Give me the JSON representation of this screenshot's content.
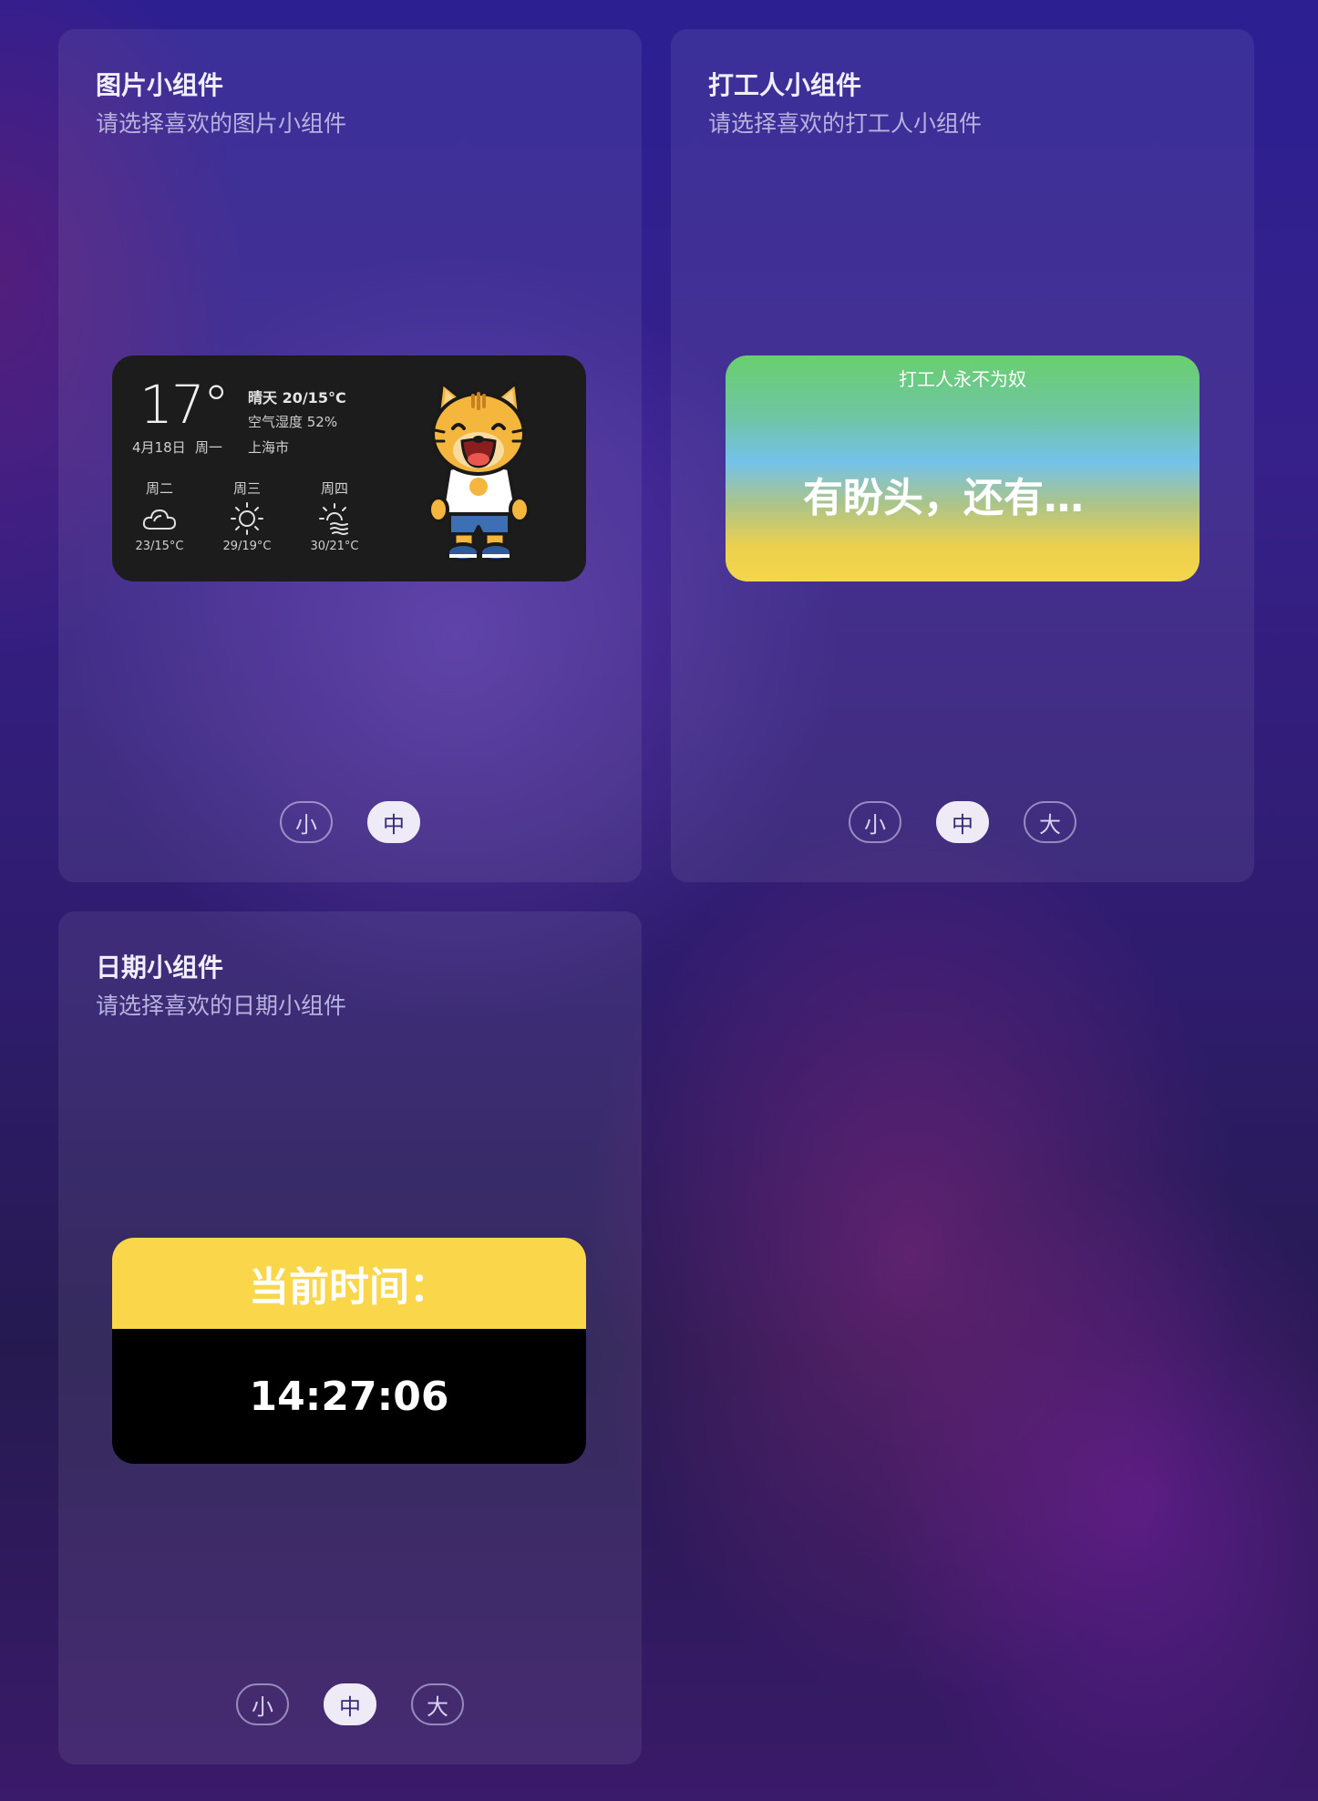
{
  "cards": {
    "photo": {
      "title": "图片小组件",
      "subtitle": "请选择喜欢的图片小组件",
      "sizes": [
        "小",
        "中"
      ],
      "selected_size": "中",
      "widget": {
        "temperature": "17°",
        "date": "4月18日",
        "weekday": "周一",
        "condition": "晴天 20/15°C",
        "humidity": "空气湿度 52%",
        "city": "上海市",
        "forecast": [
          {
            "day": "周二",
            "icon": "cloud-icon",
            "temp": "23/15°C"
          },
          {
            "day": "周三",
            "icon": "sun-icon",
            "temp": "29/19°C"
          },
          {
            "day": "周四",
            "icon": "sun-haze-icon",
            "temp": "30/21°C"
          }
        ],
        "mascot": "tiger-mascot-icon"
      }
    },
    "worker": {
      "title": "打工人小组件",
      "subtitle": "请选择喜欢的打工人小组件",
      "sizes": [
        "小",
        "中",
        "大"
      ],
      "selected_size": "中",
      "widget": {
        "header": "打工人永不为奴",
        "message": "有盼头，还有…"
      }
    },
    "date": {
      "title": "日期小组件",
      "subtitle": "请选择喜欢的日期小组件",
      "sizes": [
        "小",
        "中",
        "大"
      ],
      "selected_size": "中",
      "widget": {
        "label": "当前时间：",
        "time": "14:27:06"
      }
    }
  },
  "colors": {
    "active_size_bg": "#eeeaf6",
    "worker_gradient_top": "#69cf6e",
    "worker_gradient_mid": "#74c2ea",
    "worker_gradient_bottom": "#f4d64a",
    "date_header": "#f9d64a"
  }
}
